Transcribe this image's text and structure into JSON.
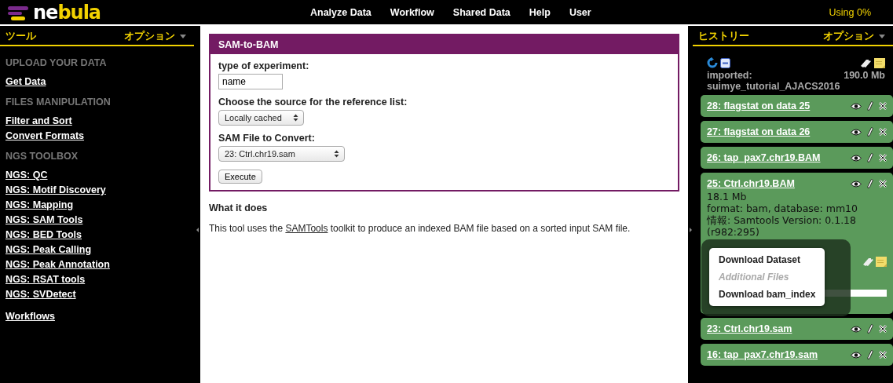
{
  "logo": {
    "first": "ne",
    "second": "bula"
  },
  "nav": [
    {
      "label": "Analyze Data"
    },
    {
      "label": "Workflow"
    },
    {
      "label": "Shared Data"
    },
    {
      "label": "Help"
    },
    {
      "label": "User"
    }
  ],
  "usage": "Using 0%",
  "tools": {
    "title": "ツール",
    "options": "オプション",
    "sections": [
      {
        "heading": "UPLOAD YOUR DATA",
        "links": [
          "Get Data"
        ]
      },
      {
        "heading": "FILES MANIPULATION",
        "links": [
          "Filter and Sort",
          "Convert Formats"
        ]
      },
      {
        "heading": "NGS TOOLBOX",
        "links": [
          "NGS: QC",
          "NGS: Motif Discovery",
          "NGS: Mapping",
          "NGS: SAM Tools",
          "NGS: BED Tools",
          "NGS: Peak Calling",
          "NGS: Peak Annotation",
          "NGS: RSAT tools",
          "NGS: SVDetect"
        ]
      }
    ],
    "footer_link": "Workflows"
  },
  "tool_form": {
    "title": "SAM-to-BAM",
    "fields": [
      {
        "kind": "text",
        "label": "type of experiment:",
        "value": "name"
      },
      {
        "kind": "select",
        "label": "Choose the source for the reference list:",
        "value": "Locally cached"
      },
      {
        "kind": "select",
        "label": "SAM File to Convert:",
        "value": "23: Ctrl.chr19.sam"
      }
    ],
    "button": "Execute",
    "help_heading": "What it does",
    "help_before": "This tool uses the ",
    "help_link": "SAMTools",
    "help_after": " toolkit to produce an indexed BAM file based on a sorted input SAM file."
  },
  "history": {
    "title": "ヒストリー",
    "options": "オプション",
    "name_label": "imported:",
    "name": "suimye_tutorial_AJACS2016",
    "size": "190.0 Mb",
    "datasets": [
      {
        "label": "28: flagstat on data 25",
        "expanded": false
      },
      {
        "label": "27: flagstat on data 26",
        "expanded": false
      },
      {
        "label": "26: tap_pax7.chr19.BAM",
        "expanded": false
      },
      {
        "label": "25: Ctrl.chr19.BAM",
        "expanded": true,
        "details": [
          "18.1 Mb",
          "format: bam, database: mm10",
          "情報: Samtools Version: 0.1.18 (r982:295)"
        ]
      },
      {
        "label": "23: Ctrl.chr19.sam",
        "expanded": false
      },
      {
        "label": "16: tap_pax7.chr19.sam",
        "expanded": false
      }
    ]
  },
  "popup_menu": [
    {
      "label": "Download Dataset",
      "disabled": false
    },
    {
      "label": "Additional Files",
      "disabled": true
    },
    {
      "label": "Download bam_index",
      "disabled": false
    }
  ]
}
